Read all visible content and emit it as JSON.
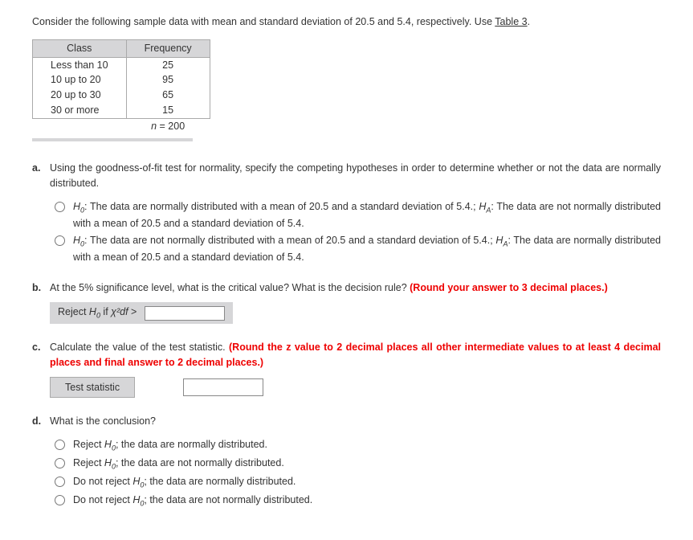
{
  "intro": {
    "text": "Consider the following sample data with mean and standard deviation of 20.5 and 5.4, respectively. Use ",
    "link": "Table 3",
    "suffix": "."
  },
  "table": {
    "headers": {
      "col1": "Class",
      "col2": "Frequency"
    },
    "rows": [
      {
        "class": "Less than 10",
        "freq": "25"
      },
      {
        "class": "10 up to 20",
        "freq": "95"
      },
      {
        "class": "20 up to 30",
        "freq": "65"
      },
      {
        "class": "30 or more",
        "freq": "15"
      }
    ],
    "total_label": "n = 200"
  },
  "questions": {
    "a": {
      "label": "a.",
      "text": "Using the goodness-of-fit test for normality, specify the competing hypotheses in order to determine whether or not the data are normally distributed.",
      "options": [
        {
          "h0_prefix": "H",
          "h0_sub": "0",
          "h0_text": ": The data are normally distributed with a mean of 20.5 and a standard deviation of 5.4.; ",
          "ha_prefix": "H",
          "ha_sub": "A",
          "ha_text": ": The data are not normally distributed with a mean of 20.5 and a standard deviation of 5.4."
        },
        {
          "h0_prefix": "H",
          "h0_sub": "0",
          "h0_text": ": The data are not normally distributed with a mean of 20.5 and a standard deviation of 5.4.; ",
          "ha_prefix": "H",
          "ha_sub": "A",
          "ha_text": ": The data are normally distributed with a mean of 20.5 and a standard deviation of 5.4."
        }
      ]
    },
    "b": {
      "label": "b.",
      "text": "At the 5% significance level, what is the critical value? What is the decision rule? ",
      "red": "(Round your answer to 3 decimal places.)",
      "reject_prefix": "Reject ",
      "reject_h0": "H",
      "reject_sub": "0",
      "reject_if": " if ",
      "chi_symbol": "χ²df",
      "gt": " > "
    },
    "c": {
      "label": "c.",
      "text": "Calculate the value of the test statistic. ",
      "red": "(Round the z value to 2 decimal places all other intermediate values to at least 4 decimal places and final answer to 2 decimal places.)",
      "stat_label": "Test statistic"
    },
    "d": {
      "label": "d.",
      "text": "What is the conclusion?",
      "options": [
        {
          "prefix": "Reject ",
          "h": "H",
          "sub": "0",
          "suffix": "; the data are normally distributed."
        },
        {
          "prefix": "Reject ",
          "h": "H",
          "sub": "0",
          "suffix": "; the data are not normally distributed."
        },
        {
          "prefix": "Do not reject ",
          "h": "H",
          "sub": "0",
          "suffix": "; the data are normally distributed."
        },
        {
          "prefix": "Do not reject ",
          "h": "H",
          "sub": "0",
          "suffix": "; the data are not normally distributed."
        }
      ]
    }
  }
}
